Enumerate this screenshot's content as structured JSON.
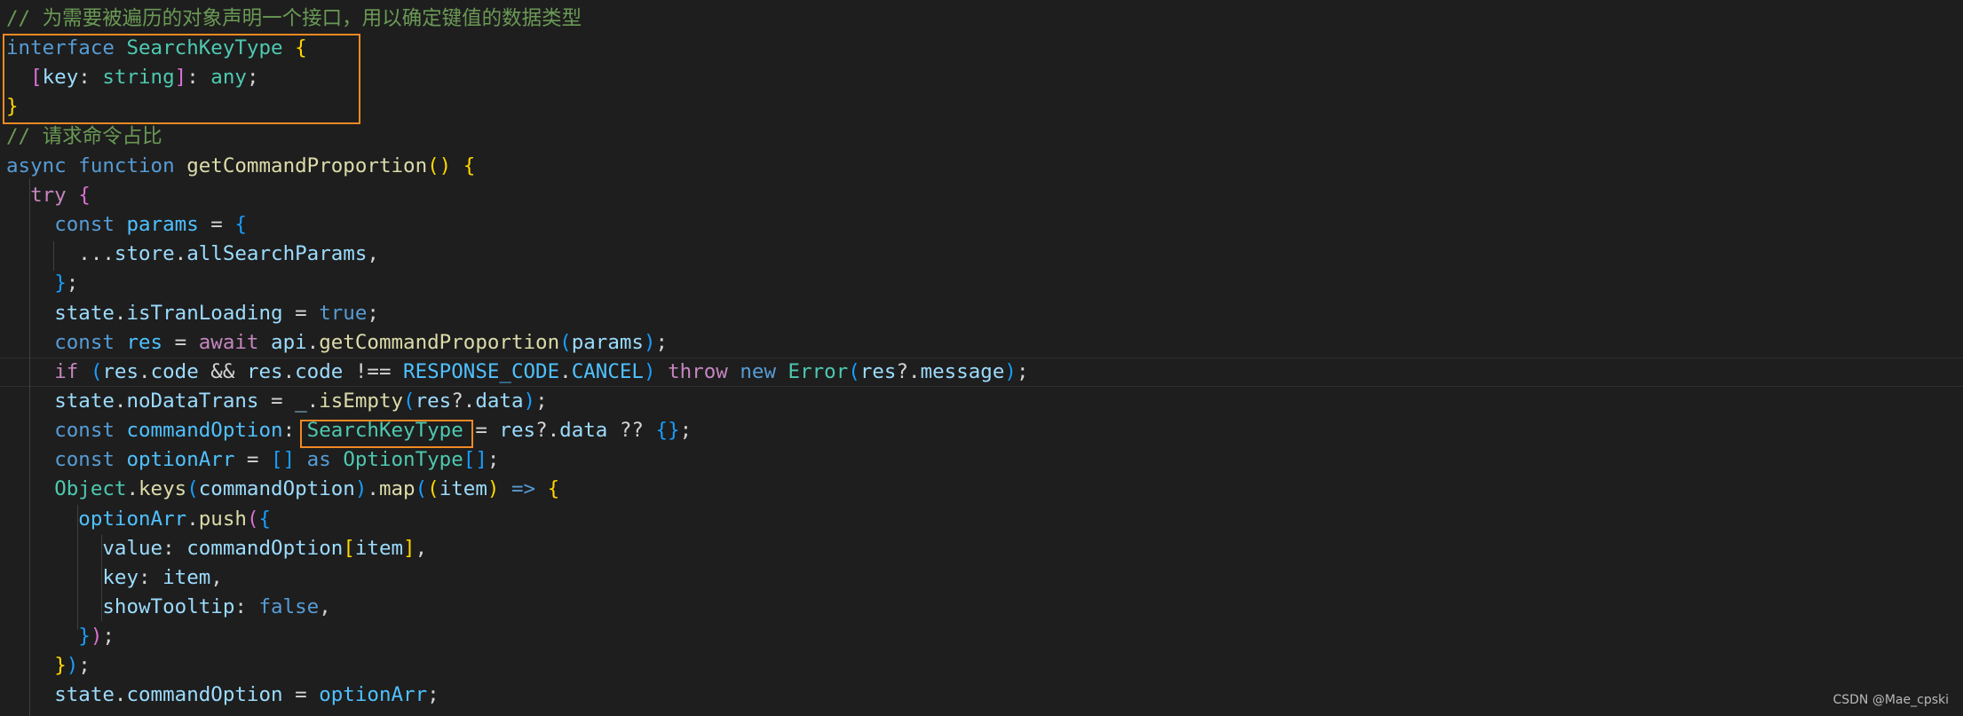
{
  "colors": {
    "background": "#1e1e1e",
    "comment": "#6a9955",
    "keyword": "#569cd6",
    "control": "#c586c0",
    "type": "#4ec9b0",
    "function": "#dcdcaa",
    "variable": "#9cdcfe",
    "constant": "#4fc1ff",
    "bracket_1": "#ffd700",
    "bracket_2": "#da70d6",
    "bracket_3": "#179fff",
    "highlight_box": "#f08a24"
  },
  "code": {
    "lines": [
      [
        [
          "cm",
          "// 为需要被遍历的对象声明一个接口，用以确定键值的数据类型"
        ]
      ],
      [
        [
          "kw",
          "interface"
        ],
        [
          "pl",
          " "
        ],
        [
          "ty",
          "SearchKeyType"
        ],
        [
          "pl",
          " "
        ],
        [
          "b1",
          "{"
        ]
      ],
      [
        [
          "pl",
          "  "
        ],
        [
          "b2",
          "["
        ],
        [
          "var",
          "key"
        ],
        [
          "pl",
          ": "
        ],
        [
          "ty",
          "string"
        ],
        [
          "b2",
          "]"
        ],
        [
          "pl",
          ": "
        ],
        [
          "ty",
          "any"
        ],
        [
          "pl",
          ";"
        ]
      ],
      [
        [
          "b1",
          "}"
        ]
      ],
      [
        [
          "cm",
          "// 请求命令占比"
        ]
      ],
      [
        [
          "kw",
          "async"
        ],
        [
          "pl",
          " "
        ],
        [
          "kw",
          "function"
        ],
        [
          "pl",
          " "
        ],
        [
          "fn",
          "getCommandProportion"
        ],
        [
          "b1",
          "()"
        ],
        [
          "pl",
          " "
        ],
        [
          "b1",
          "{"
        ]
      ],
      [
        [
          "pl",
          "  "
        ],
        [
          "ctl",
          "try"
        ],
        [
          "pl",
          " "
        ],
        [
          "b2",
          "{"
        ]
      ],
      [
        [
          "pl",
          "    "
        ],
        [
          "kw",
          "const"
        ],
        [
          "pl",
          " "
        ],
        [
          "const",
          "params"
        ],
        [
          "pl",
          " = "
        ],
        [
          "b3",
          "{"
        ]
      ],
      [
        [
          "pl",
          "      ..."
        ],
        [
          "var",
          "store"
        ],
        [
          "pl",
          "."
        ],
        [
          "var",
          "allSearchParams"
        ],
        [
          "pl",
          ","
        ]
      ],
      [
        [
          "pl",
          "    "
        ],
        [
          "b3",
          "}"
        ],
        [
          "pl",
          ";"
        ]
      ],
      [
        [
          "pl",
          "    "
        ],
        [
          "var",
          "state"
        ],
        [
          "pl",
          "."
        ],
        [
          "var",
          "isTranLoading"
        ],
        [
          "pl",
          " = "
        ],
        [
          "kw",
          "true"
        ],
        [
          "pl",
          ";"
        ]
      ],
      [
        [
          "pl",
          "    "
        ],
        [
          "kw",
          "const"
        ],
        [
          "pl",
          " "
        ],
        [
          "const",
          "res"
        ],
        [
          "pl",
          " = "
        ],
        [
          "ctl",
          "await"
        ],
        [
          "pl",
          " "
        ],
        [
          "var",
          "api"
        ],
        [
          "pl",
          "."
        ],
        [
          "fn",
          "getCommandProportion"
        ],
        [
          "b3",
          "("
        ],
        [
          "var",
          "params"
        ],
        [
          "b3",
          ")"
        ],
        [
          "pl",
          ";"
        ]
      ],
      [
        [
          "pl",
          "    "
        ],
        [
          "ctl",
          "if"
        ],
        [
          "pl",
          " "
        ],
        [
          "b3",
          "("
        ],
        [
          "var",
          "res"
        ],
        [
          "pl",
          "."
        ],
        [
          "var",
          "code"
        ],
        [
          "pl",
          " && "
        ],
        [
          "var",
          "res"
        ],
        [
          "pl",
          "."
        ],
        [
          "var",
          "code"
        ],
        [
          "pl",
          " !== "
        ],
        [
          "const",
          "RESPONSE_CODE"
        ],
        [
          "pl",
          "."
        ],
        [
          "const",
          "CANCEL"
        ],
        [
          "b3",
          ")"
        ],
        [
          "pl",
          " "
        ],
        [
          "ctl",
          "throw"
        ],
        [
          "pl",
          " "
        ],
        [
          "kw",
          "new"
        ],
        [
          "pl",
          " "
        ],
        [
          "ty",
          "Error"
        ],
        [
          "b3",
          "("
        ],
        [
          "var",
          "res"
        ],
        [
          "pl",
          "?."
        ],
        [
          "var",
          "message"
        ],
        [
          "b3",
          ")"
        ],
        [
          "pl",
          ";"
        ]
      ],
      [
        [
          "pl",
          "    "
        ],
        [
          "var",
          "state"
        ],
        [
          "pl",
          "."
        ],
        [
          "var",
          "noDataTrans"
        ],
        [
          "pl",
          " = "
        ],
        [
          "var",
          "_"
        ],
        [
          "pl",
          "."
        ],
        [
          "fn",
          "isEmpty"
        ],
        [
          "b3",
          "("
        ],
        [
          "var",
          "res"
        ],
        [
          "pl",
          "?."
        ],
        [
          "var",
          "data"
        ],
        [
          "b3",
          ")"
        ],
        [
          "pl",
          ";"
        ]
      ],
      [
        [
          "pl",
          "    "
        ],
        [
          "kw",
          "const"
        ],
        [
          "pl",
          " "
        ],
        [
          "const",
          "commandOption"
        ],
        [
          "pl",
          ": "
        ],
        [
          "ty",
          "SearchKeyType"
        ],
        [
          "pl",
          " = "
        ],
        [
          "var",
          "res"
        ],
        [
          "pl",
          "?."
        ],
        [
          "var",
          "data"
        ],
        [
          "pl",
          " ?? "
        ],
        [
          "b3",
          "{}"
        ],
        [
          "pl",
          ";"
        ]
      ],
      [
        [
          "pl",
          "    "
        ],
        [
          "kw",
          "const"
        ],
        [
          "pl",
          " "
        ],
        [
          "const",
          "optionArr"
        ],
        [
          "pl",
          " = "
        ],
        [
          "b3",
          "[]"
        ],
        [
          "pl",
          " "
        ],
        [
          "kw",
          "as"
        ],
        [
          "pl",
          " "
        ],
        [
          "ty",
          "OptionType"
        ],
        [
          "b3",
          "[]"
        ],
        [
          "pl",
          ";"
        ]
      ],
      [
        [
          "pl",
          "    "
        ],
        [
          "ty",
          "Object"
        ],
        [
          "pl",
          "."
        ],
        [
          "fn",
          "keys"
        ],
        [
          "b3",
          "("
        ],
        [
          "var",
          "commandOption"
        ],
        [
          "b3",
          ")"
        ],
        [
          "pl",
          "."
        ],
        [
          "fn",
          "map"
        ],
        [
          "b3",
          "("
        ],
        [
          "b1",
          "("
        ],
        [
          "var",
          "item"
        ],
        [
          "b1",
          ")"
        ],
        [
          "pl",
          " "
        ],
        [
          "kw",
          "=>"
        ],
        [
          "pl",
          " "
        ],
        [
          "b1",
          "{"
        ]
      ],
      [
        [
          "pl",
          "      "
        ],
        [
          "const",
          "optionArr"
        ],
        [
          "pl",
          "."
        ],
        [
          "fn",
          "push"
        ],
        [
          "b2",
          "("
        ],
        [
          "b3",
          "{"
        ]
      ],
      [
        [
          "pl",
          "        "
        ],
        [
          "var",
          "value"
        ],
        [
          "pl",
          ": "
        ],
        [
          "var",
          "commandOption"
        ],
        [
          "b1",
          "["
        ],
        [
          "var",
          "item"
        ],
        [
          "b1",
          "]"
        ],
        [
          "pl",
          ","
        ]
      ],
      [
        [
          "pl",
          "        "
        ],
        [
          "var",
          "key"
        ],
        [
          "pl",
          ": "
        ],
        [
          "var",
          "item"
        ],
        [
          "pl",
          ","
        ]
      ],
      [
        [
          "pl",
          "        "
        ],
        [
          "var",
          "showTooltip"
        ],
        [
          "pl",
          ": "
        ],
        [
          "kw",
          "false"
        ],
        [
          "pl",
          ","
        ]
      ],
      [
        [
          "pl",
          "      "
        ],
        [
          "b3",
          "}"
        ],
        [
          "b2",
          ")"
        ],
        [
          "pl",
          ";"
        ]
      ],
      [
        [
          "pl",
          "    "
        ],
        [
          "b1",
          "}"
        ],
        [
          "b3",
          ")"
        ],
        [
          "pl",
          ";"
        ]
      ],
      [
        [
          "pl",
          "    "
        ],
        [
          "var",
          "state"
        ],
        [
          "pl",
          "."
        ],
        [
          "var",
          "commandOption"
        ],
        [
          "pl",
          " = "
        ],
        [
          "const",
          "optionArr"
        ],
        [
          "pl",
          ";"
        ]
      ]
    ]
  },
  "watermark": "CSDN @Mae_cpski"
}
